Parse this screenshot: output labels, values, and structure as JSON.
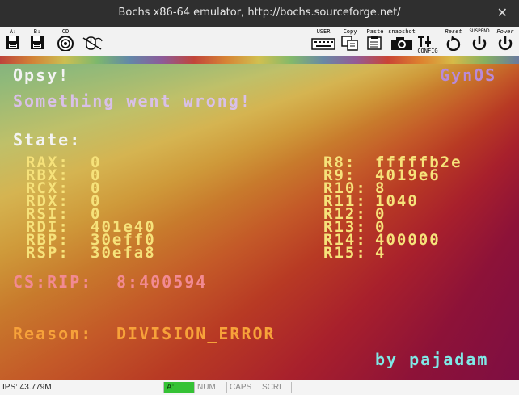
{
  "window": {
    "title": "Bochs x86-64 emulator, http://bochs.sourceforge.net/",
    "close_glyph": "✕"
  },
  "toolbar": {
    "floppy_a": "A:",
    "floppy_b": "B:",
    "cdrom": "CD",
    "user": "USER",
    "copy": "Copy",
    "paste": "Paste",
    "snapshot": "snapshot",
    "config": "CONFIG",
    "reset": "Reset",
    "suspend": "SUSPEND",
    "power": "Power"
  },
  "screen": {
    "header_left": "Opsy!",
    "header_right": "GynOS",
    "message": "Something went wrong!",
    "state_label": "State:",
    "registers_left": [
      {
        "name": "RAX:",
        "value": "0"
      },
      {
        "name": "RBX:",
        "value": "0"
      },
      {
        "name": "RCX:",
        "value": "0"
      },
      {
        "name": "RDX:",
        "value": "0"
      },
      {
        "name": "RSI:",
        "value": "0"
      },
      {
        "name": "RDI:",
        "value": "401e40"
      },
      {
        "name": "RBP:",
        "value": "30eff0"
      },
      {
        "name": "RSP:",
        "value": "30efa8"
      }
    ],
    "registers_right": [
      {
        "name": "R8:",
        "value": "fffffb2e"
      },
      {
        "name": "R9:",
        "value": "4019e6"
      },
      {
        "name": "R10:",
        "value": "8"
      },
      {
        "name": "R11:",
        "value": "1040"
      },
      {
        "name": "R12:",
        "value": "0"
      },
      {
        "name": "R13:",
        "value": "0"
      },
      {
        "name": "R14:",
        "value": "400000"
      },
      {
        "name": "R15:",
        "value": "4"
      }
    ],
    "csrip_label": "CS:RIP:",
    "csrip_value": "8:400594",
    "reason_label": "Reason:",
    "reason_value": "DIVISION_ERROR",
    "credit": "by pajadam"
  },
  "statusbar": {
    "ips": "IPS: 43.779M",
    "a": "A:",
    "num": "NUM",
    "caps": "CAPS",
    "scrl": "SCRL"
  }
}
